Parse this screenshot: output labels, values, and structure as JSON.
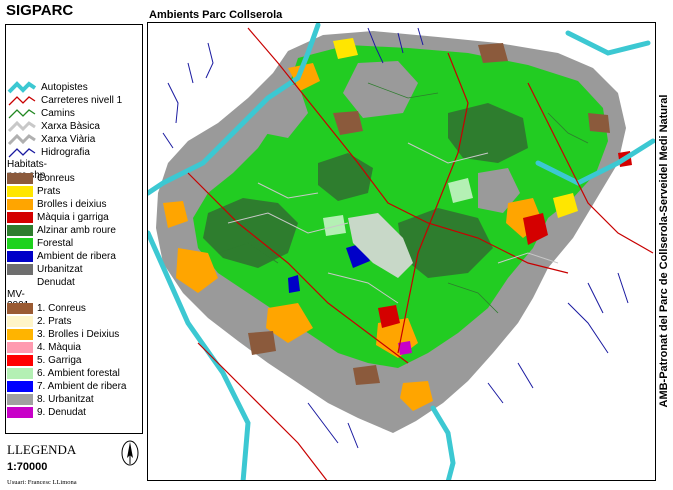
{
  "app_title": "SIGPARC",
  "map_title": "Ambients Parc Collserola",
  "credit": "AMB-Patronat del Parc de Collserola-Serveidel Medi Natural",
  "legend": {
    "title": "LLEGENDA",
    "scale": "1:70000",
    "user": "Usuari: Francesc LLimona",
    "line_items": [
      {
        "label": "Autopistes",
        "color": "#3cc8d2"
      },
      {
        "label": "Carreteres nivell 1",
        "color": "#c80000"
      },
      {
        "label": "Camins",
        "color": "#228822"
      },
      {
        "label": "Xarxa Bàsica",
        "color": "#c8c8c8"
      },
      {
        "label": "Xarxa Viària",
        "color": "#b0b0b0"
      },
      {
        "label": "Hidrografia",
        "color": "#1a1aa0"
      }
    ],
    "habitats_header": "Habitats-parc.shp",
    "habitats": [
      {
        "label": "Conreus",
        "color": "#8b5a3c"
      },
      {
        "label": "Prats",
        "color": "#ffe600"
      },
      {
        "label": "Brolles i deixius",
        "color": "#ffa500"
      },
      {
        "label": "Màquia i garriga",
        "color": "#d40000"
      },
      {
        "label": "Alzinar amb roure",
        "color": "#2e7d2e"
      },
      {
        "label": "Forestal",
        "color": "#1ed21e"
      },
      {
        "label": "Ambient de ribera",
        "color": "#0000c8"
      },
      {
        "label": "Urbanitzat",
        "color": "#6e6e6e"
      },
      {
        "label": "Denudat",
        "color": "#ffffff"
      }
    ],
    "mv_header": "MV-2001",
    "mv": [
      {
        "label": "1. Conreus",
        "color": "#9a5a32"
      },
      {
        "label": "2. Prats",
        "color": "#fff5c8"
      },
      {
        "label": "3. Brolles i Deixius",
        "color": "#ffb400"
      },
      {
        "label": "4. Màquia",
        "color": "#ff9ab0"
      },
      {
        "label": "5. Garriga",
        "color": "#ff0000"
      },
      {
        "label": "6. Ambient forestal",
        "color": "#b4f0b4"
      },
      {
        "label": "7. Ambient de ribera",
        "color": "#0000ff"
      },
      {
        "label": "8. Urbanitzat",
        "color": "#a0a0a0"
      },
      {
        "label": "9. Denudat",
        "color": "#c800c8"
      }
    ]
  }
}
